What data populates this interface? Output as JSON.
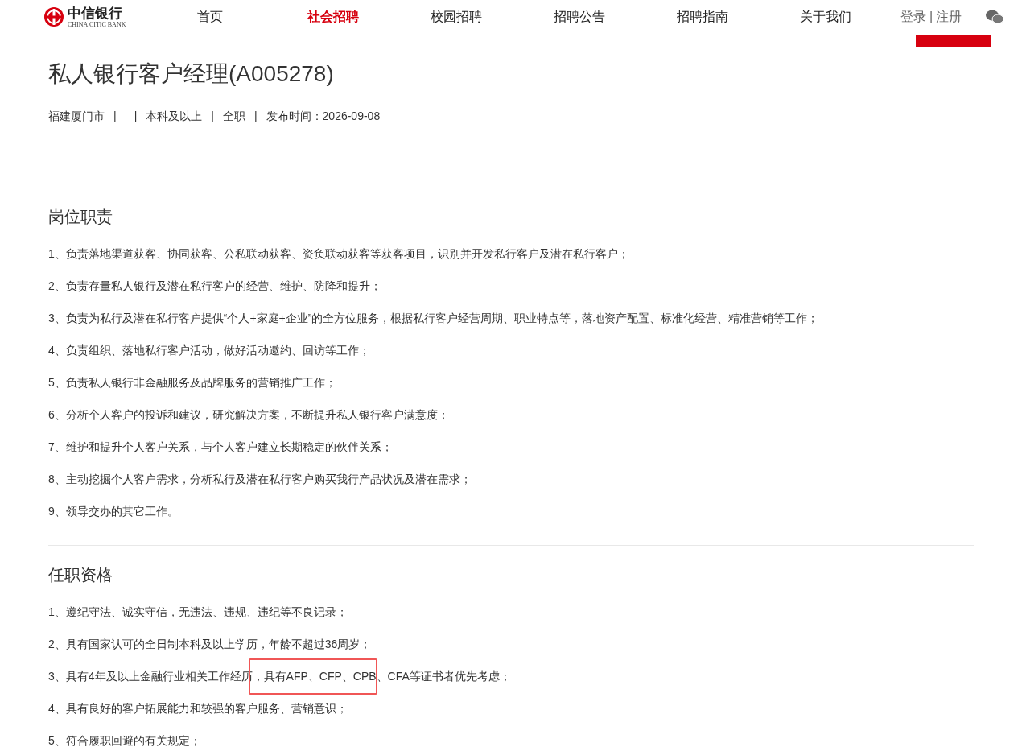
{
  "header": {
    "logo": {
      "name": "中信银行",
      "subtitle": "CHINA CITIC BANK"
    },
    "nav": [
      {
        "label": "首页",
        "selected": false
      },
      {
        "label": "社会招聘",
        "selected": true
      },
      {
        "label": "校园招聘",
        "selected": false
      },
      {
        "label": "招聘公告",
        "selected": false
      },
      {
        "label": "招聘指南",
        "selected": false
      },
      {
        "label": "关于我们",
        "selected": false
      }
    ],
    "login": "登录",
    "separator": "|",
    "register": "注册"
  },
  "job": {
    "title": "私人银行客户经理(A005278)",
    "meta": [
      "福建厦门市",
      "|",
      "|",
      "本科及以上",
      "|",
      "全职",
      "|",
      "发布时间：2026-09-08"
    ]
  },
  "sections": [
    {
      "heading": "岗位职责",
      "items": [
        "1、负责落地渠道获客、协同获客、公私联动获客、资负联动获客等获客项目，识别并开发私行客户及潜在私行客户；",
        "2、负责存量私人银行及潜在私行客户的经营、维护、防降和提升；",
        "3、负责为私行及潜在私行客户提供“个人+家庭+企业”的全方位服务，根据私行客户经营周期、职业特点等，落地资产配置、标准化经营、精准营销等工作；",
        "4、负责组织、落地私行客户活动，做好活动邀约、回访等工作；",
        "5、负责私人银行非金融服务及品牌服务的营销推广工作；",
        "6、分析个人客户的投诉和建议，研究解决方案，不断提升私人银行客户满意度；",
        "7、维护和提升个人客户关系，与个人客户建立长期稳定的伙伴关系；",
        "8、主动挖掘个人客户需求，分析私行及潜在私行客户购买我行产品状况及潜在需求；",
        "9、领导交办的其它工作。"
      ]
    },
    {
      "heading": "任职资格",
      "items": [
        "1、遵纪守法、诚实守信，无违法、违规、违纪等不良记录；",
        "2、具有国家认可的全日制本科及以上学历，年龄不超过36周岁；",
        "3、具有4年及以上金融行业相关工作经历，具有AFP、CFP、CPB、CFA等证书者优先考虑；",
        "4、具有良好的客户拓展能力和较强的客户服务、营销意识；",
        "5、符合履职回避的有关规定；"
      ]
    }
  ]
}
